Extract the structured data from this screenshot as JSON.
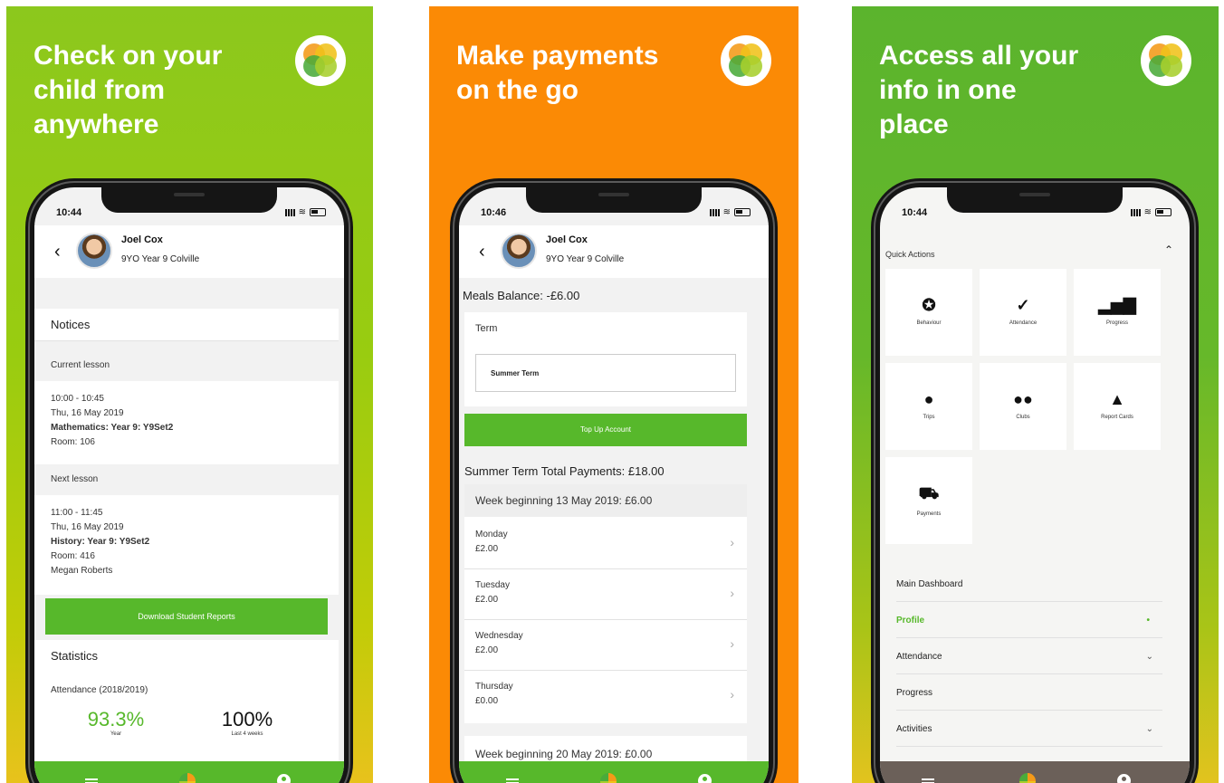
{
  "panel1": {
    "headline": [
      "Check on your",
      "child from",
      "anywhere"
    ],
    "time": "10:44",
    "child": {
      "name": "Joel Cox",
      "meta": "9YO  Year 9  Colville"
    },
    "notices": "Notices",
    "current_lesson": {
      "label": "Current lesson",
      "time": "10:00 - 10:45",
      "date": "Thu, 16 May 2019",
      "subject": "Mathematics: Year 9: Y9Set2",
      "room": "Room: 106"
    },
    "next_lesson": {
      "label": "Next lesson",
      "time": "11:00 - 11:45",
      "date": "Thu, 16 May 2019",
      "subject": "History: Year 9: Y9Set2",
      "room": "Room: 416",
      "teacher": "Megan Roberts"
    },
    "download_button": "Download Student Reports",
    "statistics": "Statistics",
    "attendance_label": "Attendance (2018/2019)",
    "stat_year": {
      "value": "93.3%",
      "label": "Year"
    },
    "stat_weeks": {
      "value": "100%",
      "label": "Last 4 weeks"
    }
  },
  "panel2": {
    "headline": [
      "Make payments",
      "on the go"
    ],
    "time": "10:46",
    "child": {
      "name": "Joel Cox",
      "meta": "9YO  Year 9  Colville"
    },
    "meals_balance": "Meals Balance: -£6.00",
    "term_label": "Term",
    "term_value": "Summer Term",
    "topup_button": "Top Up Account",
    "total_payments": "Summer Term Total Payments: £18.00",
    "week_header": "Week beginning 13 May 2019: £6.00",
    "days": [
      {
        "day": "Monday",
        "amount": "£2.00"
      },
      {
        "day": "Tuesday",
        "amount": "£2.00"
      },
      {
        "day": "Wednesday",
        "amount": "£2.00"
      },
      {
        "day": "Thursday",
        "amount": "£0.00"
      }
    ],
    "next_week_partial": "Week beginning 20 May 2019: £0.00"
  },
  "panel3": {
    "headline": [
      "Access all your",
      "info in one",
      "place"
    ],
    "time": "10:44",
    "quick_actions": "Quick Actions",
    "tiles": [
      {
        "label": "Behaviour",
        "icon": "award-icon"
      },
      {
        "label": "Attendance",
        "icon": "check-circle-icon"
      },
      {
        "label": "Progress",
        "icon": "bar-chart-icon"
      },
      {
        "label": "Trips",
        "icon": "location-pin-icon"
      },
      {
        "label": "Clubs",
        "icon": "group-icon"
      },
      {
        "label": "Report Cards",
        "icon": "person-icon"
      },
      {
        "label": "Payments",
        "icon": "cart-icon"
      }
    ],
    "menu": [
      "Main Dashboard",
      "Profile",
      "Attendance",
      "Progress",
      "Activities"
    ],
    "active_color": "#57b82b"
  },
  "colors": {
    "green_panel": "#8cc81d",
    "orange_panel": "#fb8a05",
    "accent_green": "#57b82b",
    "tabbar_brown": "#6b6059"
  }
}
